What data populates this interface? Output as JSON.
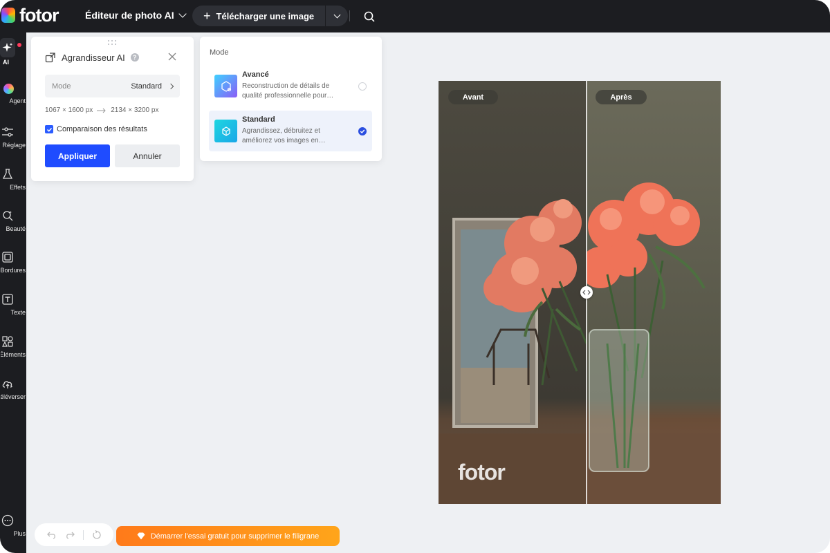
{
  "app": {
    "logo_text": "fotor",
    "editor_menu_label": "Éditeur de photo AI",
    "upload_label": "Télécharger une image"
  },
  "sidebar": {
    "items": [
      {
        "label": "AI",
        "icon": "sparkle-icon"
      },
      {
        "label": "Agent",
        "icon": "agent-orb-icon"
      },
      {
        "label": "Réglage",
        "icon": "sliders-icon"
      },
      {
        "label": "Effets",
        "icon": "flask-icon"
      },
      {
        "label": "Beauté",
        "icon": "beauty-icon"
      },
      {
        "label": "Bordures",
        "icon": "frame-icon"
      },
      {
        "label": "Texte",
        "icon": "text-icon"
      },
      {
        "label": "Éléments",
        "icon": "shapes-icon"
      },
      {
        "label": "Téléverser",
        "icon": "cloud-upload-icon"
      },
      {
        "label": "Plus",
        "icon": "more-icon"
      }
    ]
  },
  "ai_panel": {
    "title": "Agrandisseur AI",
    "mode_label": "Mode",
    "mode_value": "Standard",
    "size_from": "1067 × 1600 px",
    "size_to": "2134 × 3200 px",
    "compare_label": "Comparaison des résultats",
    "compare_checked": true,
    "apply_label": "Appliquer",
    "cancel_label": "Annuler"
  },
  "mode_panel": {
    "title": "Mode",
    "options": [
      {
        "name": "Avancé",
        "desc": "Reconstruction de détails de qualité professionnelle pour…",
        "selected": false
      },
      {
        "name": "Standard",
        "desc": "Agrandissez, débruitez et améliorez vos images en…",
        "selected": true
      }
    ]
  },
  "preview": {
    "before_label": "Avant",
    "after_label": "Après",
    "watermark": "fotor"
  },
  "bottom": {
    "trial_label": "Démarrer l'essai gratuit pour supprimer le filigrane"
  },
  "colors": {
    "dark_bar": "#1c1d21",
    "primary_blue": "#1f4cff",
    "trial_orange": "#ff8a1a"
  }
}
